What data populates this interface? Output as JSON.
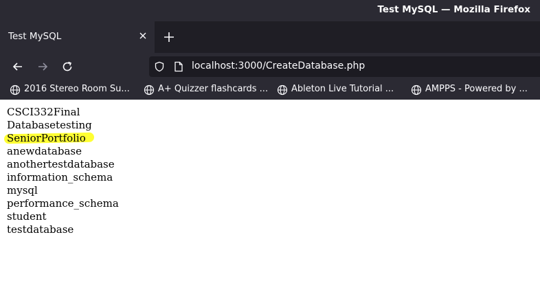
{
  "window": {
    "title": "Test MySQL — Mozilla Firefox"
  },
  "tab": {
    "label": "Test MySQL"
  },
  "toolbar": {
    "url": "localhost:3000/CreateDatabase.php"
  },
  "bookmarks": [
    {
      "label": "2016 Stereo Room Su..."
    },
    {
      "label": "A+ Quizzer flashcards ..."
    },
    {
      "label": "Ableton Live Tutorial ..."
    },
    {
      "label": "AMPPS - Powered by ..."
    }
  ],
  "databases": [
    "CSCI332Final",
    "Databasetesting",
    "SeniorPortfolio",
    "anewdatabase",
    "anothertestdatabase",
    "information_schema",
    "mysql",
    "performance_schema",
    "student",
    "testdatabase"
  ],
  "highlight": {
    "color": "#ffff33",
    "item": "SeniorPortfolio"
  }
}
